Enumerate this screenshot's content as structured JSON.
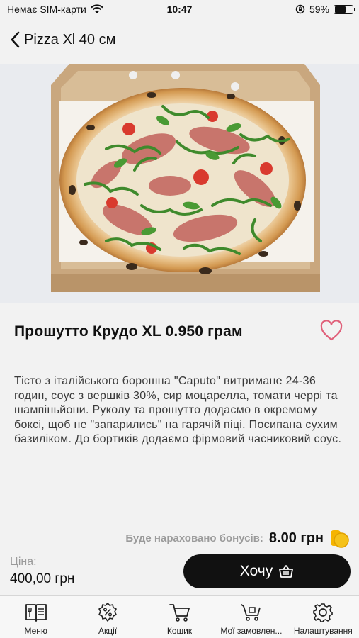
{
  "status_bar": {
    "carrier": "Немає SIM-карти",
    "time": "10:47",
    "battery": "59%",
    "battery_level": 0.59
  },
  "nav": {
    "title": "Pizza Xl 40 см"
  },
  "product": {
    "title": "Прошутто Крудо XL 0.950 грам",
    "description": "Тісто з італійського борошна \"Caputo\" витримане 24-36 годин, соус з вершків 30%, сир моцарелла, томати черрі та шампіньйони. Руколу та прошутто додаємо в окремому боксі, щоб не \"запарились\" на гарячій піці. Посипана сухим базиліком.  До бортиків додаємо фірмовий часниковий соус."
  },
  "bonus": {
    "label": "Буде нараховано бонусів:",
    "value": "8.00 грн"
  },
  "price": {
    "label": "Ціна:",
    "value": "400,00 грн"
  },
  "cta": {
    "label": "Хочу"
  },
  "tabs": [
    {
      "label": "Меню",
      "icon": "menu-book-icon"
    },
    {
      "label": "Акції",
      "icon": "discount-badge-icon"
    },
    {
      "label": "Кошик",
      "icon": "cart-icon"
    },
    {
      "label": "Мої замовлен...",
      "icon": "order-cart-icon"
    },
    {
      "label": "Налаштування",
      "icon": "gear-icon"
    }
  ],
  "colors": {
    "accent": "#111111",
    "favorite": "#e0607a",
    "bonus_coin": "#f5b400",
    "background": "#f2f2f2"
  }
}
